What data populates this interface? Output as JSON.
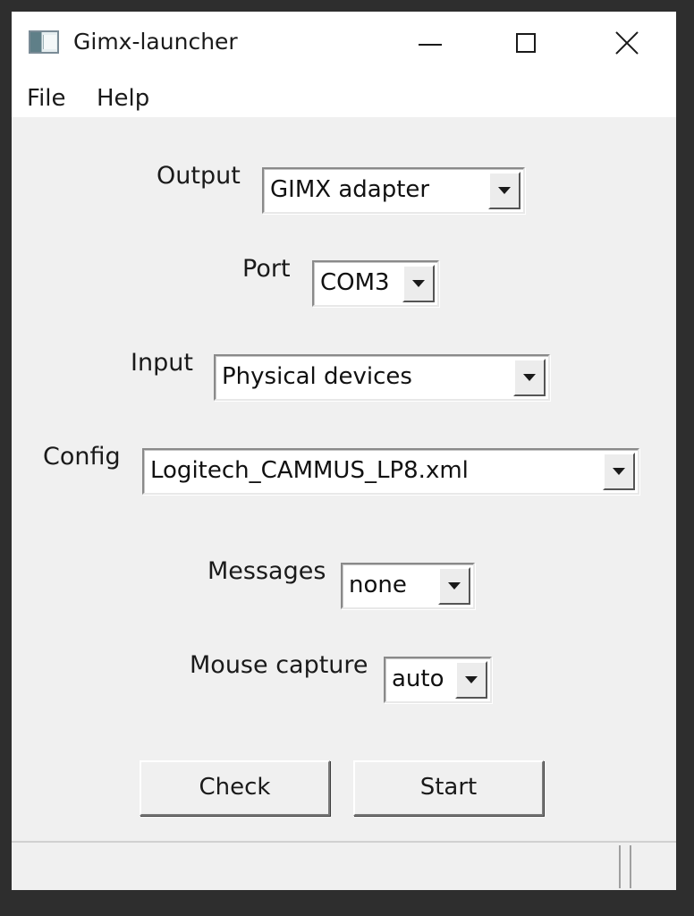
{
  "window": {
    "title": "Gimx-launcher",
    "icon": "app-window-icon"
  },
  "caption_buttons": {
    "minimize_icon": "minimize-icon",
    "maximize_icon": "maximize-icon",
    "close_icon": "close-icon"
  },
  "menu": {
    "items": [
      {
        "label": "File"
      },
      {
        "label": "Help"
      }
    ]
  },
  "form": {
    "output": {
      "label": "Output",
      "value": "GIMX adapter"
    },
    "port": {
      "label": "Port",
      "value": "COM3"
    },
    "input": {
      "label": "Input",
      "value": "Physical devices"
    },
    "config": {
      "label": "Config",
      "value": "Logitech_CAMMUS_LP8.xml"
    },
    "messages": {
      "label": "Messages",
      "value": "none"
    },
    "mouse_capture": {
      "label": "Mouse capture",
      "value": "auto"
    }
  },
  "buttons": {
    "check_label": "Check",
    "start_label": "Start"
  },
  "statusbar": {
    "text": ""
  },
  "colors": {
    "window_background": "#f0f0f0",
    "titlebar_background": "#ffffff",
    "frame": "#2e2e2e"
  }
}
